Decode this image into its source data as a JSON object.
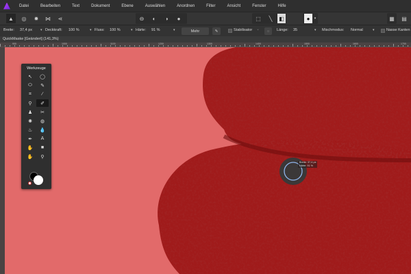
{
  "menu": [
    "Datei",
    "Bearbeiten",
    "Text",
    "Dokument",
    "Ebene",
    "Auswählen",
    "Anordnen",
    "Filter",
    "Ansicht",
    "Fenster",
    "Hilfe"
  ],
  "context": {
    "width_label": "Breite:",
    "width_value": "37,4 px",
    "opacity_label": "Deckkraft:",
    "opacity_value": "100 %",
    "flow_label": "Fluss:",
    "flow_value": "100 %",
    "hardness_label": "Härte:",
    "hardness_value": "91 %",
    "more_label": "Mehr",
    "stabilizer_label": "Stabilisator",
    "length_label": "Länge:",
    "length_value": "35",
    "blend_label": "Mischmodus:",
    "blend_value": "Normal",
    "wet_edges_label": "Nasse Kanten"
  },
  "document": {
    "title": "QuickMaske [Geändert] (141,3%)"
  },
  "ruler": {
    "labels": [
      "900",
      "1000",
      "1100",
      "1200",
      "1300",
      "1400",
      "1500",
      "1600",
      "1700"
    ]
  },
  "tools_panel": {
    "title": "Werkzeuge"
  },
  "cursor_tooltip": {
    "width": "Breite: 37,4 px",
    "hardness": "Härte: 91 %"
  },
  "colors": {
    "canvas": "#e26a6a",
    "rock": "#a11c1c",
    "accent": "#8a3cf0"
  }
}
